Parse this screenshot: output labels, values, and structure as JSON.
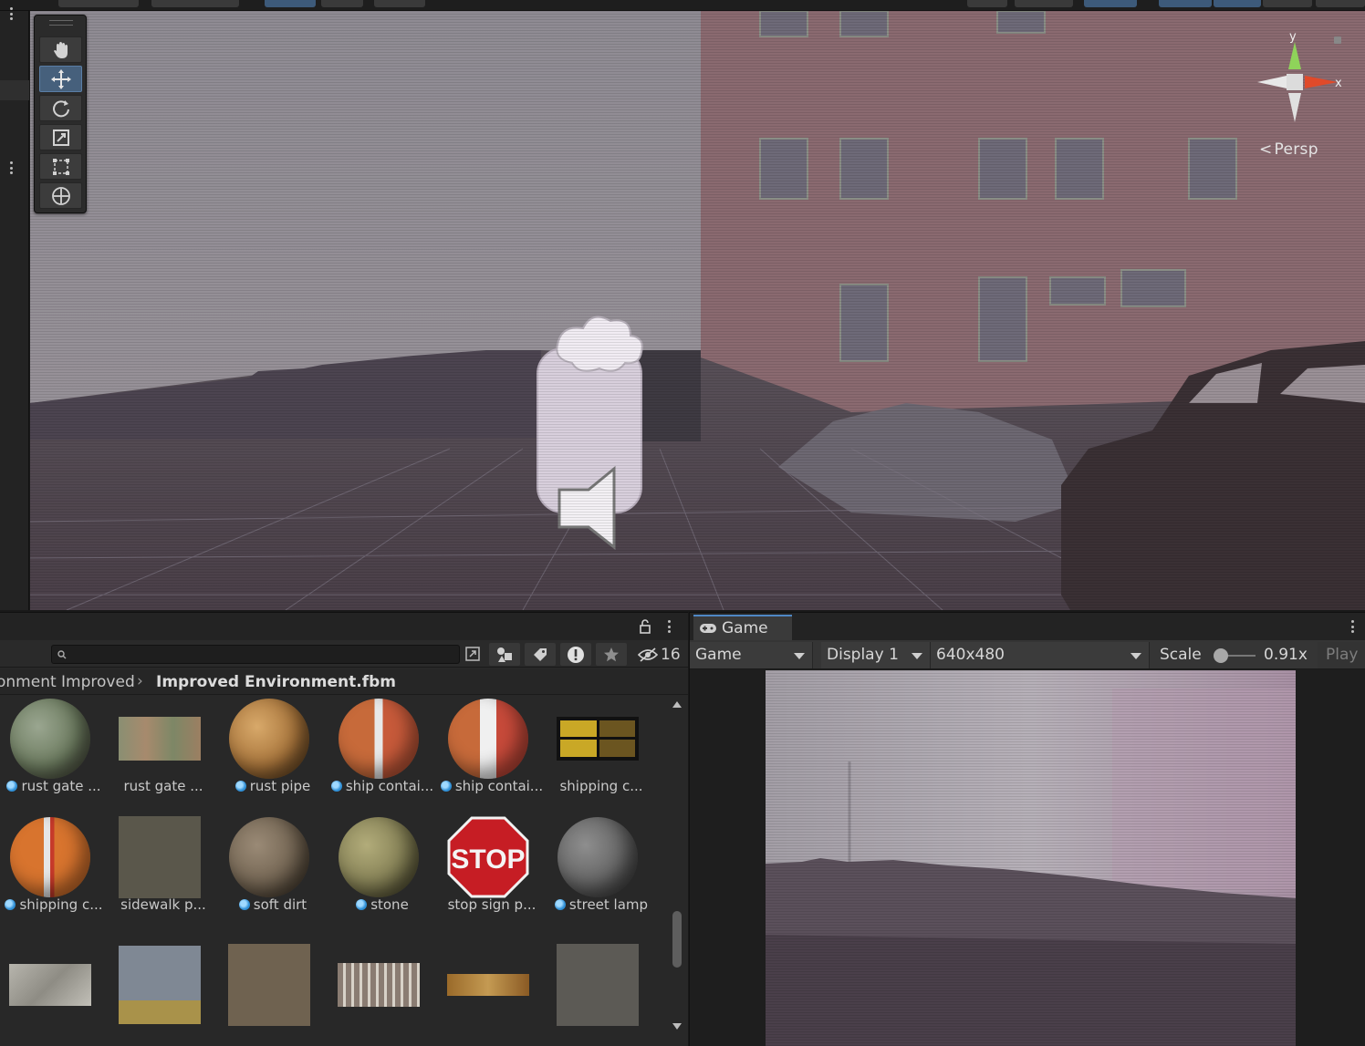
{
  "scene": {
    "view_mode_label": "Persp",
    "gizmo_axes": {
      "y": "y",
      "x": "x"
    },
    "tools": [
      {
        "name": "hand-tool",
        "active": false
      },
      {
        "name": "move-tool",
        "active": true
      },
      {
        "name": "rotate-tool",
        "active": false
      },
      {
        "name": "scale-tool",
        "active": false
      },
      {
        "name": "rect-tool",
        "active": false
      },
      {
        "name": "transform-tool",
        "active": false
      }
    ]
  },
  "project": {
    "search": {
      "placeholder": "",
      "value": ""
    },
    "hidden_packages_count": "16",
    "breadcrumb": [
      "onment Improved",
      "Improved Environment.fbm"
    ],
    "assets": [
      {
        "label": "rust gate ...",
        "badge": true
      },
      {
        "label": "rust gate ...",
        "badge": false
      },
      {
        "label": "rust pipe",
        "badge": true
      },
      {
        "label": "ship contai...",
        "badge": true
      },
      {
        "label": "ship contai...",
        "badge": true
      },
      {
        "label": "shipping c...",
        "badge": false
      },
      {
        "label": "shipping c...",
        "badge": true
      },
      {
        "label": "sidewalk p...",
        "badge": false
      },
      {
        "label": "soft dirt",
        "badge": true
      },
      {
        "label": "stone",
        "badge": true
      },
      {
        "label": "stop sign p...",
        "badge": false
      },
      {
        "label": "street lamp",
        "badge": true
      }
    ],
    "stop_sign_text": "STOP"
  },
  "game": {
    "tab_label": "Game",
    "mode_dropdown": "Game",
    "display_dropdown": "Display 1",
    "resolution_dropdown": "640x480",
    "scale_label": "Scale",
    "scale_value": "0.91x",
    "play_label": "Play"
  },
  "colors": {
    "accent": "#4f87c4",
    "active_tool": "#46607c",
    "panel_bg": "#282828",
    "toolbar_bg": "#353535"
  }
}
